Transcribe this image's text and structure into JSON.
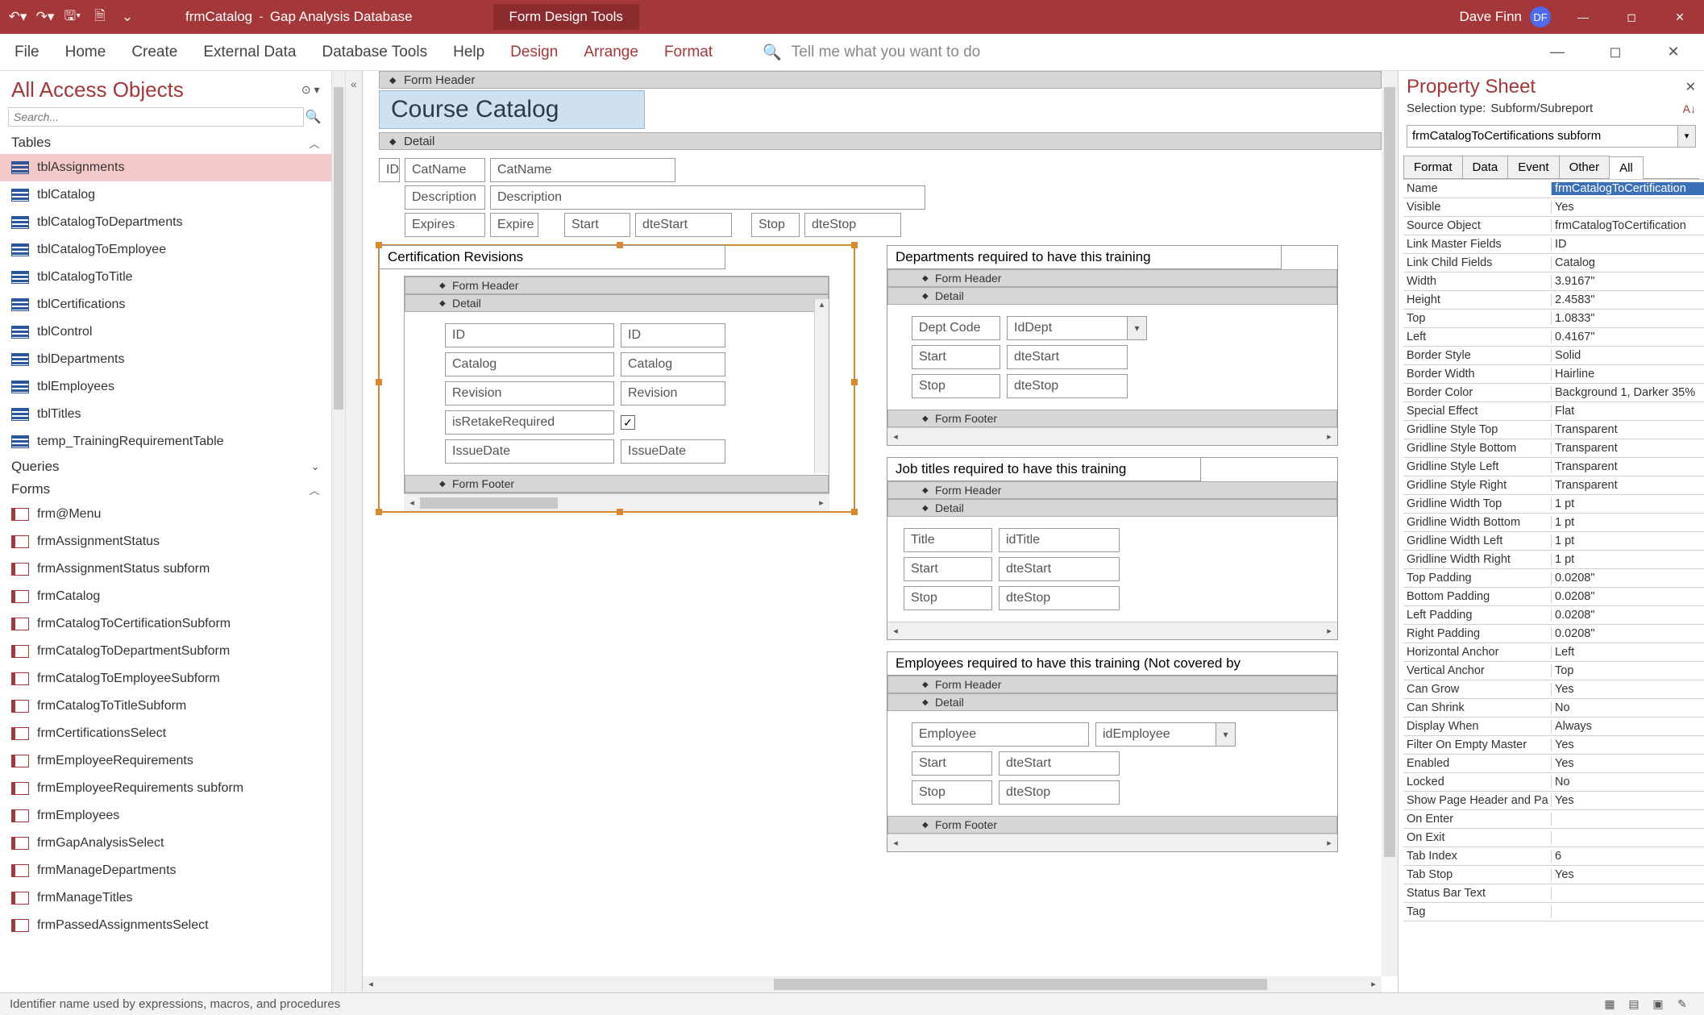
{
  "titlebar": {
    "doc": "frmCatalog",
    "app": "Gap Analysis Database",
    "tools": "Form Design Tools",
    "user": "Dave Finn",
    "initials": "DF"
  },
  "ribbon": {
    "tabs": [
      "File",
      "Home",
      "Create",
      "External Data",
      "Database Tools",
      "Help",
      "Design",
      "Arrange",
      "Format"
    ],
    "activeTabs": [
      "Design",
      "Arrange",
      "Format"
    ],
    "tellme": "Tell me what you want to do"
  },
  "nav": {
    "title": "All Access Objects",
    "search_placeholder": "Search...",
    "groups": {
      "tables": {
        "label": "Tables",
        "items": [
          "tblAssignments",
          "tblCatalog",
          "tblCatalogToDepartments",
          "tblCatalogToEmployee",
          "tblCatalogToTitle",
          "tblCertifications",
          "tblControl",
          "tblDepartments",
          "tblEmployees",
          "tblTitles",
          "temp_TrainingRequirementTable"
        ],
        "selected": "tblAssignments"
      },
      "queries": {
        "label": "Queries"
      },
      "forms": {
        "label": "Forms",
        "items": [
          "frm@Menu",
          "frmAssignmentStatus",
          "frmAssignmentStatus subform",
          "frmCatalog",
          "frmCatalogToCertificationSubform",
          "frmCatalogToDepartmentSubform",
          "frmCatalogToEmployeeSubform",
          "frmCatalogToTitleSubform",
          "frmCertificationsSelect",
          "frmEmployeeRequirements",
          "frmEmployeeRequirements subform",
          "frmEmployees",
          "frmGapAnalysisSelect",
          "frmManageDepartments",
          "frmManageTitles",
          "frmPassedAssignmentsSelect"
        ]
      }
    }
  },
  "design": {
    "sections": {
      "form_header": "Form Header",
      "detail": "Detail",
      "form_footer": "Form Footer"
    },
    "title": "Course Catalog",
    "main": {
      "id": "ID",
      "catname_label": "CatName",
      "catname_bound": "CatName",
      "desc_label": "Description",
      "desc_bound": "Description",
      "expires_label": "Expires",
      "expires_bound": "Expire",
      "start_label": "Start",
      "start_bound": "dteStart",
      "stop_label": "Stop",
      "stop_bound": "dteStop"
    },
    "sub_cert": {
      "title": "Certification Revisions",
      "rows": [
        {
          "lbl": "ID",
          "val": "ID"
        },
        {
          "lbl": "Catalog",
          "val": "Catalog"
        },
        {
          "lbl": "Revision",
          "val": "Revision"
        },
        {
          "lbl": "isRetakeRequired",
          "val": "",
          "check": true
        },
        {
          "lbl": "IssueDate",
          "val": "IssueDate"
        }
      ]
    },
    "sub_dept": {
      "title": "Departments required to have this training",
      "rows": [
        {
          "lbl": "Dept Code",
          "val": "IdDept",
          "combo": true
        },
        {
          "lbl": "Start",
          "val": "dteStart"
        },
        {
          "lbl": "Stop",
          "val": "dteStop"
        }
      ]
    },
    "sub_title": {
      "title": "Job titles required to have this training",
      "rows": [
        {
          "lbl": "Title",
          "val": "idTitle"
        },
        {
          "lbl": "Start",
          "val": "dteStart"
        },
        {
          "lbl": "Stop",
          "val": "dteStop"
        }
      ]
    },
    "sub_emp": {
      "title": "Employees required to have this training (Not covered by",
      "rows": [
        {
          "lbl": "Employee",
          "val": "idEmployee",
          "combo": true,
          "wide": true
        },
        {
          "lbl": "Start",
          "val": "dteStart"
        },
        {
          "lbl": "Stop",
          "val": "dteStop"
        }
      ]
    }
  },
  "props": {
    "title": "Property Sheet",
    "seltype_label": "Selection type:",
    "seltype_value": "Subform/Subreport",
    "object": "frmCatalogToCertifications subform",
    "tabs": [
      "Format",
      "Data",
      "Event",
      "Other",
      "All"
    ],
    "active_tab": "All",
    "rows": [
      {
        "k": "Name",
        "v": "frmCatalogToCertification",
        "sel": true
      },
      {
        "k": "Visible",
        "v": "Yes"
      },
      {
        "k": "Source Object",
        "v": "frmCatalogToCertification"
      },
      {
        "k": "Link Master Fields",
        "v": "ID"
      },
      {
        "k": "Link Child Fields",
        "v": "Catalog"
      },
      {
        "k": "Width",
        "v": "3.9167\""
      },
      {
        "k": "Height",
        "v": "2.4583\""
      },
      {
        "k": "Top",
        "v": "1.0833\""
      },
      {
        "k": "Left",
        "v": "0.4167\""
      },
      {
        "k": "Border Style",
        "v": "Solid"
      },
      {
        "k": "Border Width",
        "v": "Hairline"
      },
      {
        "k": "Border Color",
        "v": "Background 1, Darker 35%"
      },
      {
        "k": "Special Effect",
        "v": "Flat"
      },
      {
        "k": "Gridline Style Top",
        "v": "Transparent"
      },
      {
        "k": "Gridline Style Bottom",
        "v": "Transparent"
      },
      {
        "k": "Gridline Style Left",
        "v": "Transparent"
      },
      {
        "k": "Gridline Style Right",
        "v": "Transparent"
      },
      {
        "k": "Gridline Width Top",
        "v": "1 pt"
      },
      {
        "k": "Gridline Width Bottom",
        "v": "1 pt"
      },
      {
        "k": "Gridline Width Left",
        "v": "1 pt"
      },
      {
        "k": "Gridline Width Right",
        "v": "1 pt"
      },
      {
        "k": "Top Padding",
        "v": "0.0208\""
      },
      {
        "k": "Bottom Padding",
        "v": "0.0208\""
      },
      {
        "k": "Left Padding",
        "v": "0.0208\""
      },
      {
        "k": "Right Padding",
        "v": "0.0208\""
      },
      {
        "k": "Horizontal Anchor",
        "v": "Left"
      },
      {
        "k": "Vertical Anchor",
        "v": "Top"
      },
      {
        "k": "Can Grow",
        "v": "Yes"
      },
      {
        "k": "Can Shrink",
        "v": "No"
      },
      {
        "k": "Display When",
        "v": "Always"
      },
      {
        "k": "Filter On Empty Master",
        "v": "Yes"
      },
      {
        "k": "Enabled",
        "v": "Yes"
      },
      {
        "k": "Locked",
        "v": "No"
      },
      {
        "k": "Show Page Header and Pa",
        "v": "Yes"
      },
      {
        "k": "On Enter",
        "v": ""
      },
      {
        "k": "On Exit",
        "v": ""
      },
      {
        "k": "Tab Index",
        "v": "6"
      },
      {
        "k": "Tab Stop",
        "v": "Yes"
      },
      {
        "k": "Status Bar Text",
        "v": ""
      },
      {
        "k": "Tag",
        "v": ""
      }
    ]
  },
  "status": {
    "text": "Identifier name used by expressions, macros, and procedures"
  }
}
